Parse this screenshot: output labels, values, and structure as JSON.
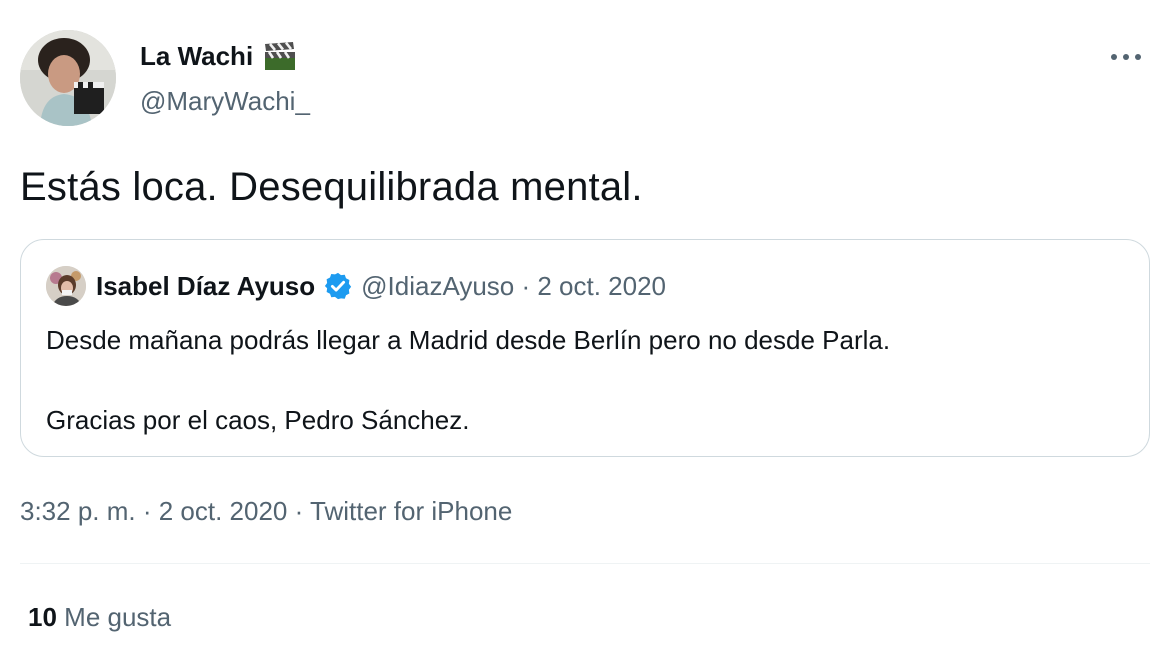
{
  "author": {
    "display_name": "La Wachi",
    "emoji_icon": "clapperboard-icon",
    "handle": "@MaryWachi_"
  },
  "tweet": {
    "text": "Estás loca. Desequilibrada mental."
  },
  "quoted_tweet": {
    "display_name": "Isabel Díaz Ayuso",
    "verified_icon": "verified-badge-icon",
    "meta": "@IdiazAyuso · 2 oct. 2020",
    "lines": [
      "Desde mañana podrás llegar a Madrid desde Berlín pero no desde Parla.",
      "Gracias por el caos, Pedro Sánchez."
    ]
  },
  "timestamp": "3:32 p. m. · 2 oct. 2020 · Twitter for iPhone",
  "stats": {
    "likes_count": "10",
    "likes_label": "Me gusta"
  },
  "colors": {
    "primary_text": "#0f1419",
    "secondary_text": "#536471",
    "border": "#cfd9de",
    "verified_blue": "#1d9bf0"
  }
}
